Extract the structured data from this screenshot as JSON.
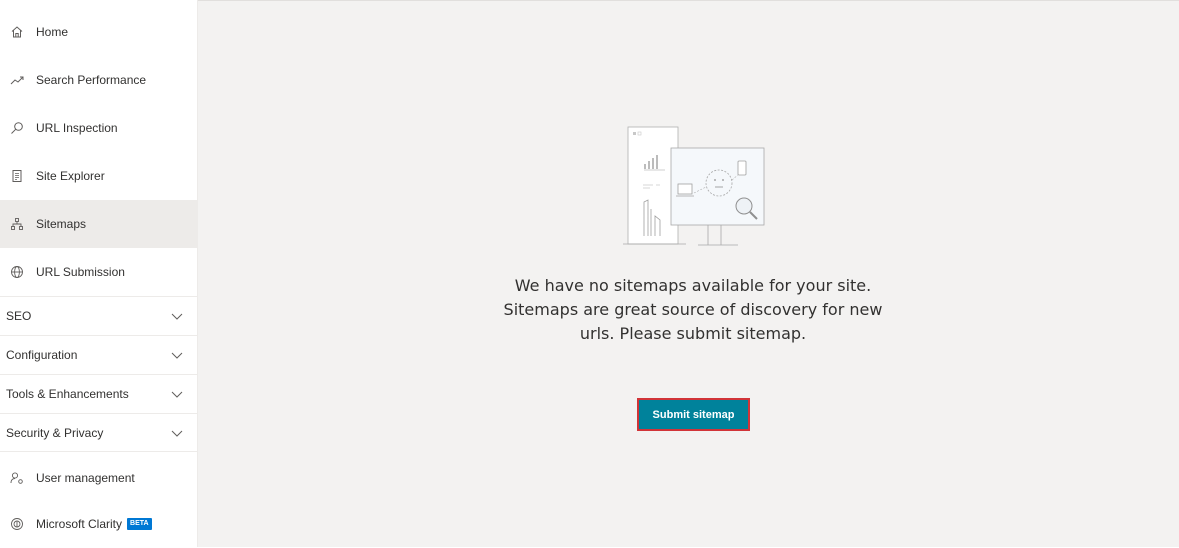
{
  "sidebar": {
    "items": [
      {
        "label": "Home",
        "icon": "home-icon"
      },
      {
        "label": "Search Performance",
        "icon": "trend-icon"
      },
      {
        "label": "URL Inspection",
        "icon": "search-icon"
      },
      {
        "label": "Site Explorer",
        "icon": "document-icon"
      },
      {
        "label": "Sitemaps",
        "icon": "sitemap-icon",
        "active": true
      },
      {
        "label": "URL Submission",
        "icon": "globe-icon"
      }
    ],
    "groups": [
      {
        "label": "SEO"
      },
      {
        "label": "Configuration"
      },
      {
        "label": "Tools & Enhancements"
      },
      {
        "label": "Security & Privacy"
      }
    ],
    "bottom_items": [
      {
        "label": "User management",
        "icon": "users-icon"
      },
      {
        "label": "Microsoft Clarity",
        "icon": "clarity-icon",
        "badge": "BETA"
      }
    ]
  },
  "main": {
    "empty_message": "We have no sitemaps available for your site. Sitemaps are great source of discovery for new urls. Please submit sitemap.",
    "submit_button_label": "Submit sitemap"
  },
  "colors": {
    "accent": "#00829b",
    "highlight_border": "#d13438",
    "active_nav_bg": "#edebe9",
    "badge_bg": "#0078d4",
    "main_bg": "#f3f2f1"
  }
}
